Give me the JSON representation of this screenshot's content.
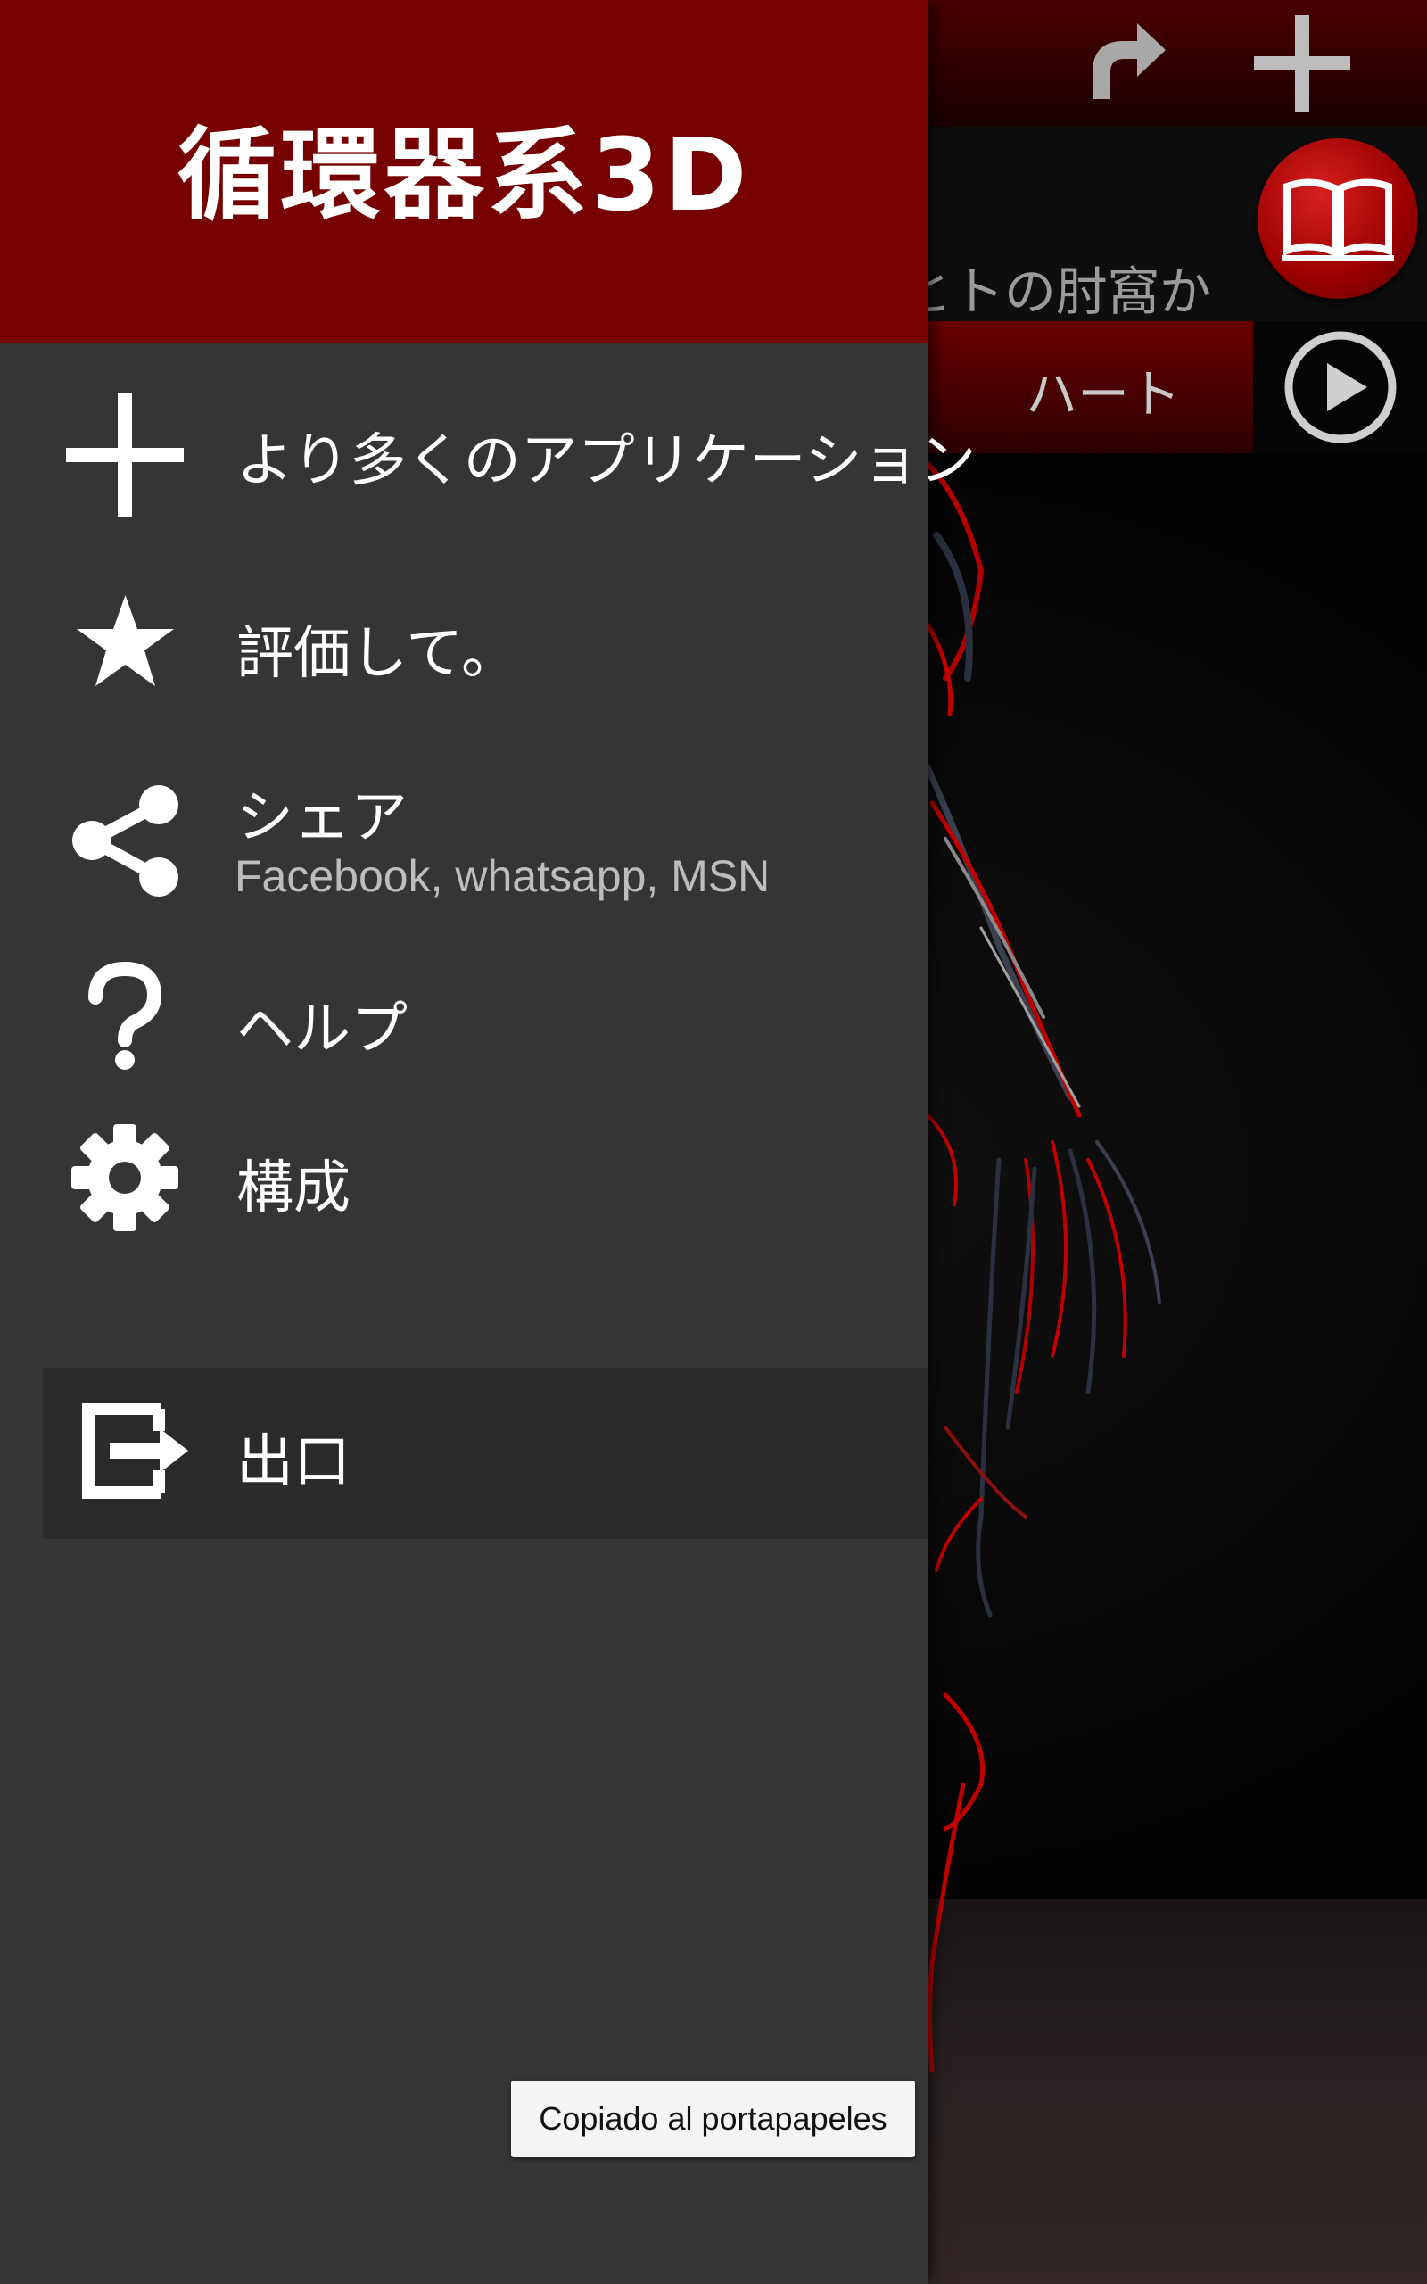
{
  "app": {
    "title": "循環器系3D"
  },
  "background": {
    "description_text": "とトの肘窩か",
    "selector_label": "ハート",
    "icons": {
      "redo": "redo-icon",
      "add": "plus-icon",
      "book": "book-icon",
      "play": "play-icon"
    }
  },
  "drawer": {
    "items": [
      {
        "label": "より多くのアプリケーション",
        "icon": "plus-icon"
      },
      {
        "label": "評価して。",
        "icon": "star-icon"
      },
      {
        "label": "シェア",
        "sublabel": "Facebook, whatsapp, MSN",
        "icon": "share-icon"
      },
      {
        "label": "ヘルプ",
        "icon": "help-icon"
      },
      {
        "label": "構成",
        "icon": "gear-icon"
      },
      {
        "label": "出口",
        "icon": "exit-icon"
      }
    ]
  },
  "toast": {
    "message": "Copiado al portapapeles"
  },
  "colors": {
    "header_red": "#770000",
    "drawer_bg": "#363534",
    "book_red": "#c00000"
  }
}
